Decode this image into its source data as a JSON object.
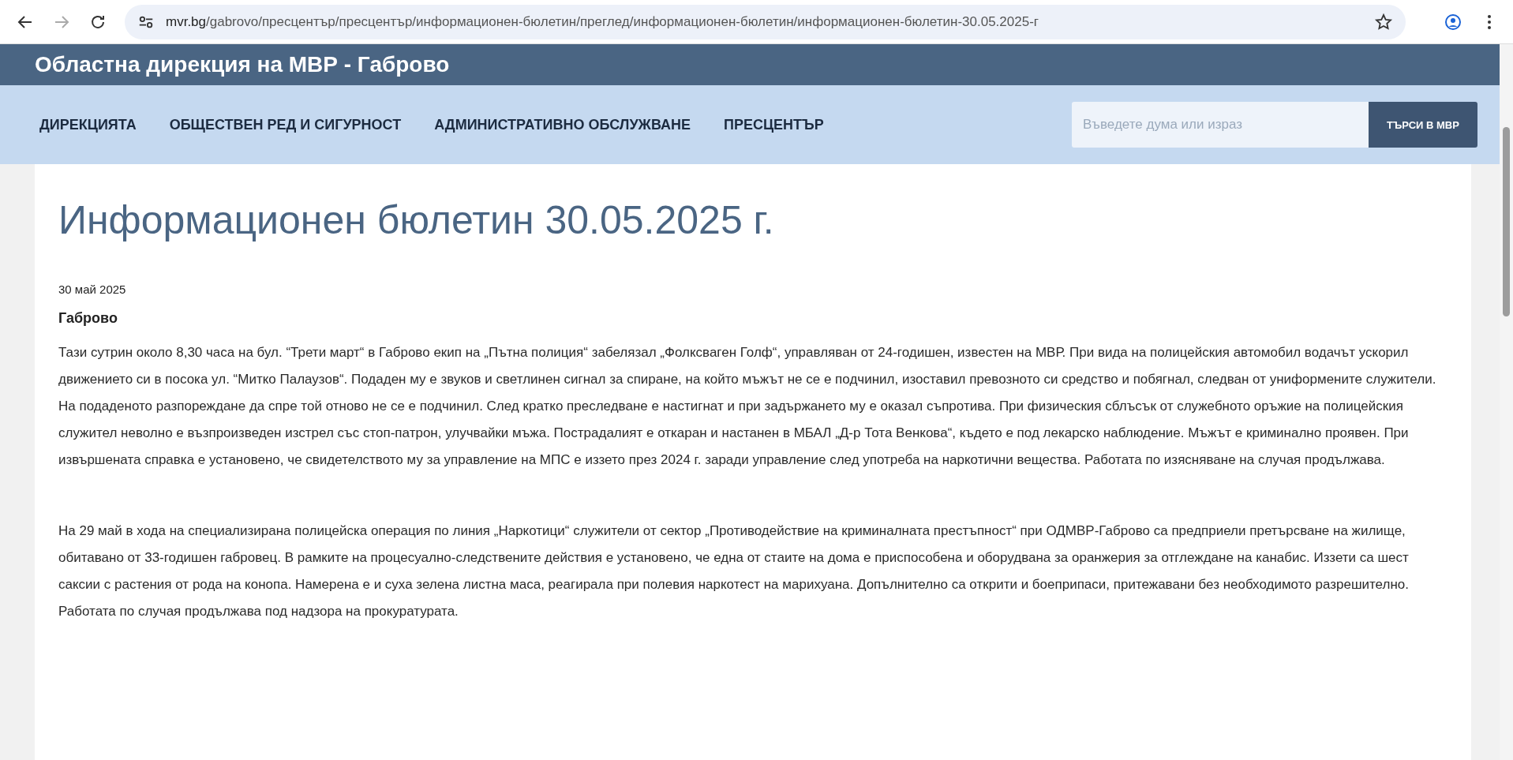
{
  "browser": {
    "url_host": "mvr.bg",
    "url_path": "/gabrovo/пресцентър/пресцентър/информационен-бюлетин/преглед/информационен-бюлетин/информационен-бюлетин-30.05.2025-г",
    "forward_enabled": false
  },
  "header": {
    "title": "Областна дирекция на МВР - Габрово"
  },
  "nav": {
    "items": [
      {
        "label": "ДИРЕКЦИЯТА"
      },
      {
        "label": "ОБЩЕСТВЕН РЕД И СИГУРНОСТ"
      },
      {
        "label": "АДМИНИСТРАТИВНО ОБСЛУЖВАНЕ"
      },
      {
        "label": "ПРЕСЦЕНТЪР"
      }
    ],
    "search": {
      "placeholder": "Въведете дума или израз",
      "button": "ТЪРСИ В МВР"
    }
  },
  "article": {
    "title": "Информационен бюлетин 30.05.2025 г.",
    "date": "30 май 2025",
    "location": "Габрово",
    "paragraphs": [
      "Тази сутрин около 8,30 часа на бул. “Трети март“ в Габрово екип на „Пътна полиция“ забелязал „Фолксваген Голф“, управляван от 24-годишен, известен на МВР. При вида на полицейския автомобил водачът ускорил движението си в посока ул. “Митко Палаузов“. Подаден му е звуков и светлинен сигнал за спиране, на който мъжът не се е подчинил, изоставил превозното си средство и побягнал, следван от униформените служители. На подаденото разпореждане да спре той отново не се е подчинил. След кратко преследване е настигнат и при задържането му е оказал съпротива. При физическия сблъсък от служебното оръжие на полицейския служител неволно е възпроизведен изстрел със стоп-патрон, улучвайки мъжа. Пострадалият е откаран и настанен в МБАЛ „Д-р Тота Венкова“, където е под лекарско наблюдение. Мъжът е криминално проявен. При извършената справка е установено, че свидетелството му за управление на МПС е иззето през 2024 г. заради управление след употреба на наркотични вещества.  Работата по изясняване на случая продължава.",
      "На 29 май в хода на специализирана полицейска операция по линия „Наркотици“ служители от сектор „Противодействие на криминалната престъпност“ при ОДМВР-Габрово са предприели претърсване на жилище, обитавано от 33-годишен габровец. В рамките на процесуално-следствените действия е установено, че една от стаите на дома е приспособена и оборудвана за оранжерия за отглеждане на канабис. Иззети са шест саксии с растения от рода на конопа. Намерена е и суха зелена листна маса, реагирала при полевия наркотест на марихуана. Допълнително са открити и боеприпаси, притежавани без необходимото разрешително. Работата по случая продължава под надзора на прокуратурата."
    ]
  }
}
